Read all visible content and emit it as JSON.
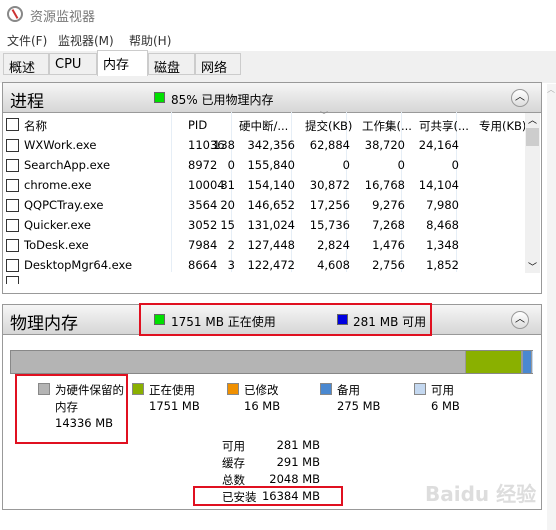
{
  "window": {
    "title": "资源监视器"
  },
  "menu": [
    "文件(F)",
    "监视器(M)",
    "帮助(H)"
  ],
  "tabs": [
    {
      "label": "概述"
    },
    {
      "label": "CPU"
    },
    {
      "label": "内存",
      "active": true
    },
    {
      "label": "磁盘"
    },
    {
      "label": "网络"
    }
  ],
  "processes": {
    "title": "进程",
    "summary": "85% 已用物理内存",
    "summary_color": "#00e000",
    "columns": [
      "名称",
      "PID",
      "硬中断/...",
      "提交(KB)",
      "工作集(...",
      "可共享(...",
      "专用(KB)"
    ],
    "sorted_column": "提交(KB)",
    "rows": [
      [
        "WXWork.exe",
        "11036",
        "138",
        "342,356",
        "62,884",
        "38,720",
        "24,164"
      ],
      [
        "SearchApp.exe",
        "8972",
        "0",
        "155,840",
        "0",
        "0",
        "0"
      ],
      [
        "chrome.exe",
        "10004",
        "31",
        "154,140",
        "30,872",
        "16,768",
        "14,104"
      ],
      [
        "QQPCTray.exe",
        "3564",
        "20",
        "146,652",
        "17,256",
        "9,276",
        "7,980"
      ],
      [
        "Quicker.exe",
        "3052",
        "15",
        "131,024",
        "15,736",
        "7,268",
        "8,468"
      ],
      [
        "ToDesk.exe",
        "7984",
        "2",
        "127,448",
        "2,824",
        "1,476",
        "1,348"
      ],
      [
        "DesktopMgr64.exe",
        "8664",
        "3",
        "122,472",
        "4,608",
        "2,756",
        "1,852"
      ]
    ]
  },
  "physical": {
    "title": "物理内存",
    "in_use_summary": "1751 MB 正在使用",
    "available_summary": "281 MB 可用",
    "bar_mb": {
      "reserved": 14336,
      "in_use": 1751,
      "modified": 16,
      "standby": 275,
      "free": 6
    },
    "legend": [
      {
        "label": "为硬件保留的",
        "label2": "内存",
        "value": "14336 MB",
        "color": "#b4b4b4"
      },
      {
        "label": "正在使用",
        "value": "1751 MB",
        "color": "#8ab000"
      },
      {
        "label": "已修改",
        "value": "16 MB",
        "color": "#f09000"
      },
      {
        "label": "备用",
        "value": "275 MB",
        "color": "#4a88d0"
      },
      {
        "label": "可用",
        "value": "6 MB",
        "color": "#c4d8f0"
      }
    ],
    "stats": [
      {
        "label": "可用",
        "value": "281 MB"
      },
      {
        "label": "缓存",
        "value": "291 MB"
      },
      {
        "label": "总数",
        "value": "2048 MB"
      },
      {
        "label": "已安装",
        "value": "16384 MB"
      }
    ]
  },
  "watermark": "Baidu 经验"
}
